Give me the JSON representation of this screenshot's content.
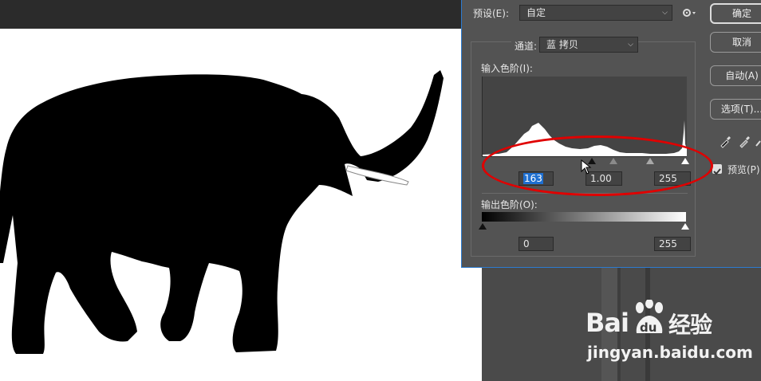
{
  "dialog": {
    "preset_label": "预设(E):",
    "preset_value": "自定",
    "channel_label": "通道:",
    "channel_value": "蓝 拷贝",
    "input_levels_label": "输入色阶(I):",
    "input_black": "163",
    "input_gamma": "1.00",
    "input_white": "255",
    "output_levels_label": "输出色阶(O):",
    "output_black": "0",
    "output_white": "255",
    "preview_label": "预览(P)",
    "preview_checked": true
  },
  "buttons": {
    "ok": "确定",
    "cancel": "取消",
    "auto": "自动(A)",
    "options": "选项(T)..."
  },
  "icons": {
    "gear": "gear-icon",
    "eyedroppers": [
      "black-eyedropper-icon",
      "gray-eyedropper-icon",
      "white-eyedropper-icon"
    ]
  },
  "watermark": {
    "brand": "Bai",
    "brand_paw": "du",
    "brand_cn": "经验",
    "url": "jingyan.baidu.com"
  },
  "colors": {
    "dialog_bg": "#535353",
    "annotation_red": "#e00000",
    "selection_blue": "#1e6fd0"
  }
}
